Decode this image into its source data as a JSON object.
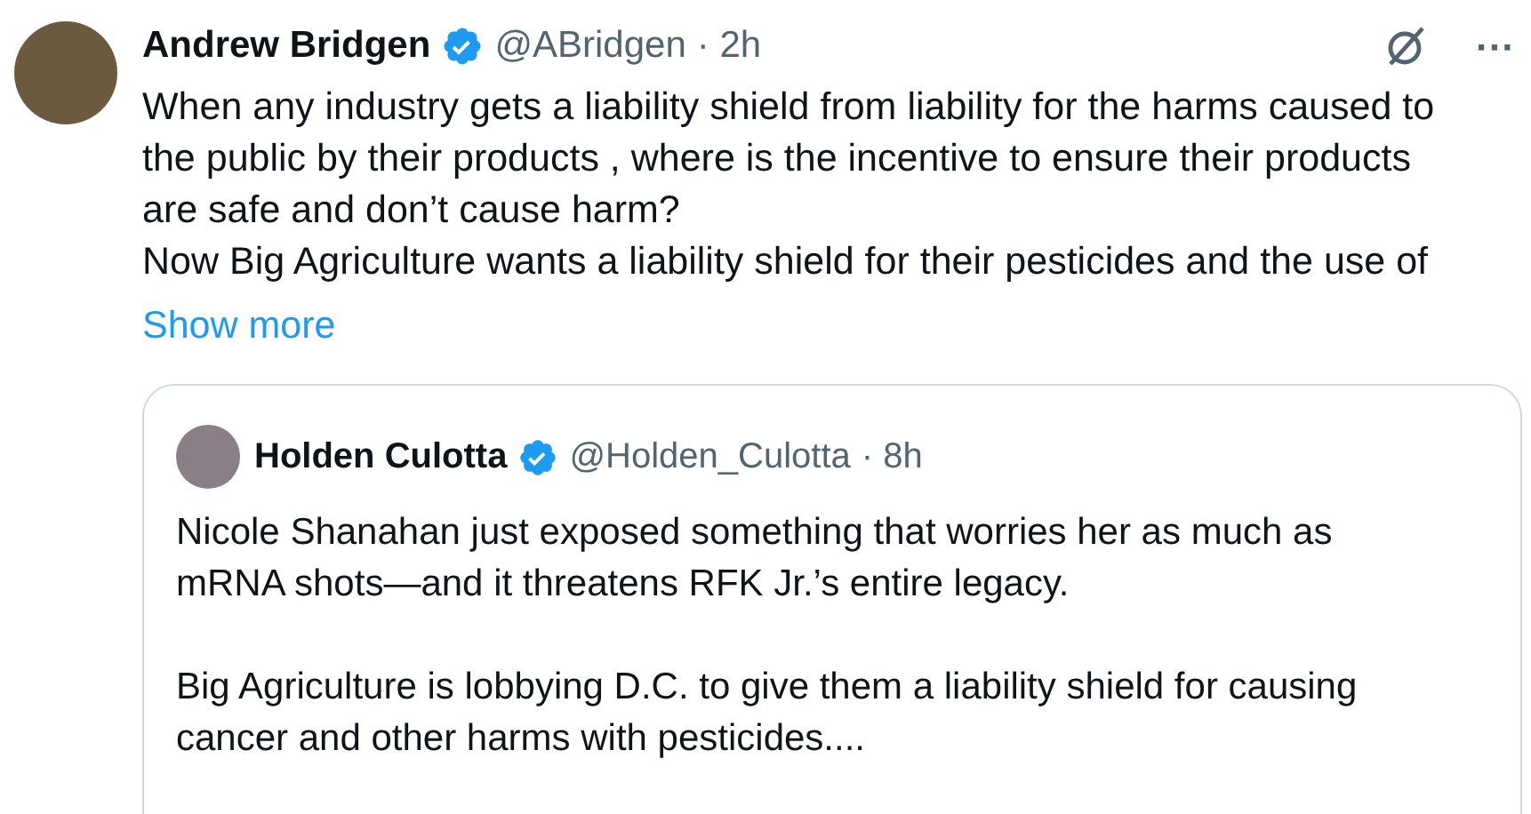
{
  "tweet": {
    "name": "Andrew Bridgen",
    "verified": true,
    "handle": "@ABridgen",
    "time": "· 2h",
    "paragraphs": [
      "When any industry gets a liability shield from liability for the harms caused to the public by their products , where is the incentive to ensure their products are safe and don’t cause harm?",
      "Now Big Agriculture wants a liability shield for their pesticides and the use of"
    ],
    "more_icon": "···",
    "show_more": "Show more"
  },
  "quote": {
    "name": "Holden Culotta",
    "verified": true,
    "handle": "@Holden_Culotta",
    "time": "· 8h",
    "paragraphs": [
      "Nicole Shanahan just exposed something that worries her as much as mRNA shots—and it threatens RFK Jr.’s entire legacy.",
      "Big Agriculture is lobbying D.C. to give them a liability shield for causing cancer and other harms with pesticides...."
    ]
  }
}
